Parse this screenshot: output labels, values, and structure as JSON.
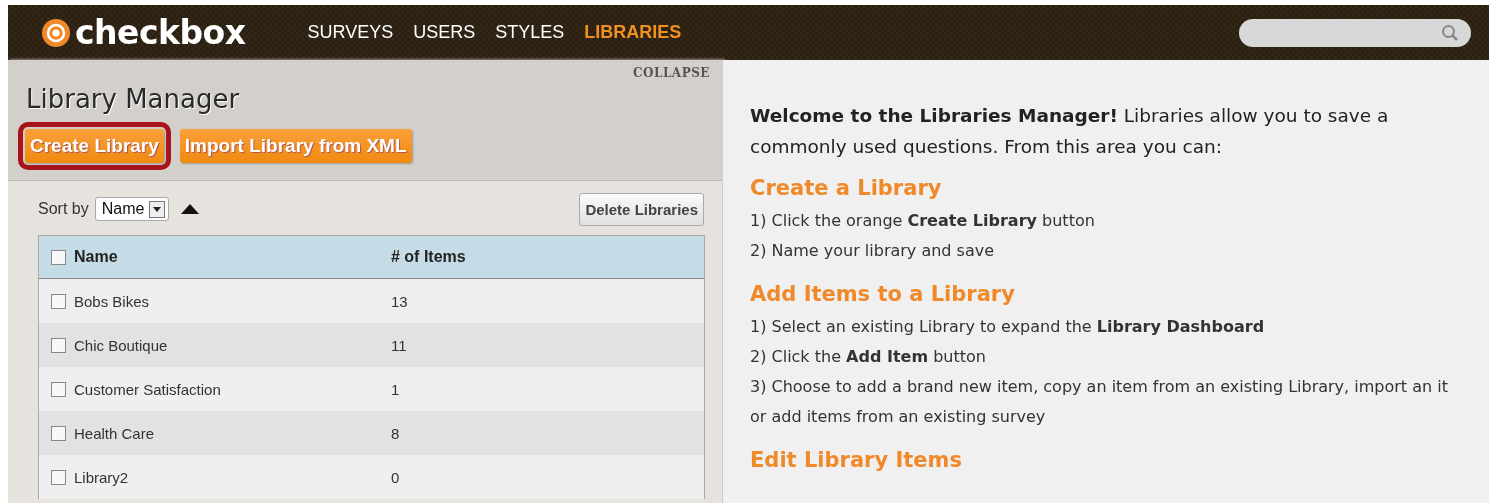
{
  "header": {
    "logo": "checkbox",
    "nav": [
      {
        "label": "SURVEYS",
        "selected": false
      },
      {
        "label": "USERS",
        "selected": false
      },
      {
        "label": "STYLES",
        "selected": false
      },
      {
        "label": "LIBRARIES",
        "selected": true
      }
    ]
  },
  "left_panel": {
    "collapse": "COLLAPSE",
    "title": "Library Manager",
    "buttons": [
      {
        "label": "Create Library",
        "highlighted": true
      },
      {
        "label": "Import Library from XML",
        "highlighted": false
      }
    ],
    "sort": {
      "label": "Sort by",
      "value": "Name",
      "ascending": true
    },
    "delete_button": "Delete Libraries",
    "table": {
      "select_all": false,
      "columns": [
        "Name",
        "# of Items"
      ],
      "rows": [
        {
          "checked": false,
          "name": "Bobs Bikes",
          "items": "13"
        },
        {
          "checked": false,
          "name": "Chic Boutique",
          "items": "11"
        },
        {
          "checked": false,
          "name": "Customer Satisfaction",
          "items": "1"
        },
        {
          "checked": false,
          "name": "Health Care",
          "items": "8"
        },
        {
          "checked": false,
          "name": "Library2",
          "items": "0"
        }
      ]
    }
  },
  "right_panel": {
    "intro": [
      "**Welcome to the Libraries Manager!** Libraries allow you to save a",
      "commonly used questions. From this area you can:"
    ],
    "sections": [
      {
        "heading": "Create a Library",
        "steps": [
          [
            "1) Click the orange **Create Library** button"
          ],
          [
            "2) Name your library and save"
          ]
        ]
      },
      {
        "heading": "Add Items to a Library",
        "steps": [
          [
            "1) Select an existing Library to expand the **Library Dashboard**"
          ],
          [
            "2) Click the **Add Item** button"
          ],
          [
            "3) Choose to add a brand new item, copy an item from an existing Library, import an it",
            "or add items from an existing survey"
          ]
        ]
      },
      {
        "heading": "Edit Library Items"
      }
    ]
  }
}
